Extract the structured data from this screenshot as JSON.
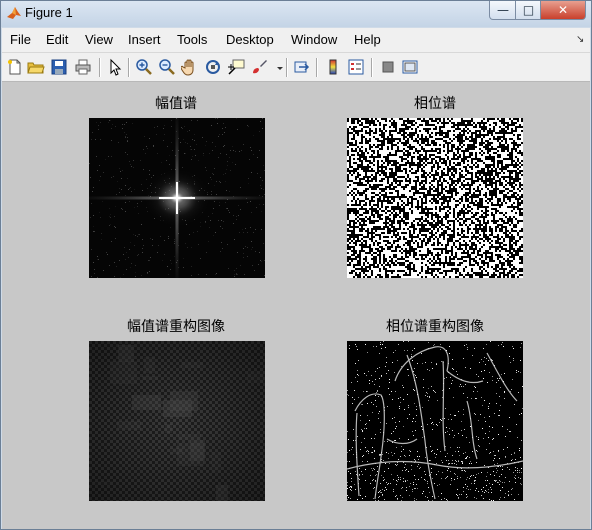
{
  "window": {
    "title": "Figure 1",
    "buttons": {
      "minimize": "—",
      "maximize": "□",
      "close": "✕"
    }
  },
  "menubar": {
    "items": [
      "File",
      "Edit",
      "View",
      "Insert",
      "Tools",
      "Desktop",
      "Window",
      "Help"
    ],
    "overflow_arrow": "↘"
  },
  "toolbar": {
    "icons": [
      "new-figure-icon",
      "open-file-icon",
      "save-icon",
      "print-icon",
      "edit-plot-arrow-icon",
      "zoom-in-icon",
      "zoom-out-icon",
      "pan-hand-icon",
      "rotate-3d-icon",
      "data-cursor-icon",
      "brush-icon",
      "link-plot-icon",
      "colorbar-icon",
      "legend-icon",
      "hide-plot-tools-icon",
      "show-plot-tools-icon"
    ]
  },
  "plots": [
    {
      "title": "幅值谱"
    },
    {
      "title": "相位谱"
    },
    {
      "title": "幅值谱重构图像"
    },
    {
      "title": "相位谱重构图像"
    }
  ],
  "colors": {
    "canvas_bg": "#c8c8c8",
    "menubar_bg": "#f0f0f0",
    "titlebar_top": "#dbe6f2",
    "close_red": "#c9402c"
  }
}
